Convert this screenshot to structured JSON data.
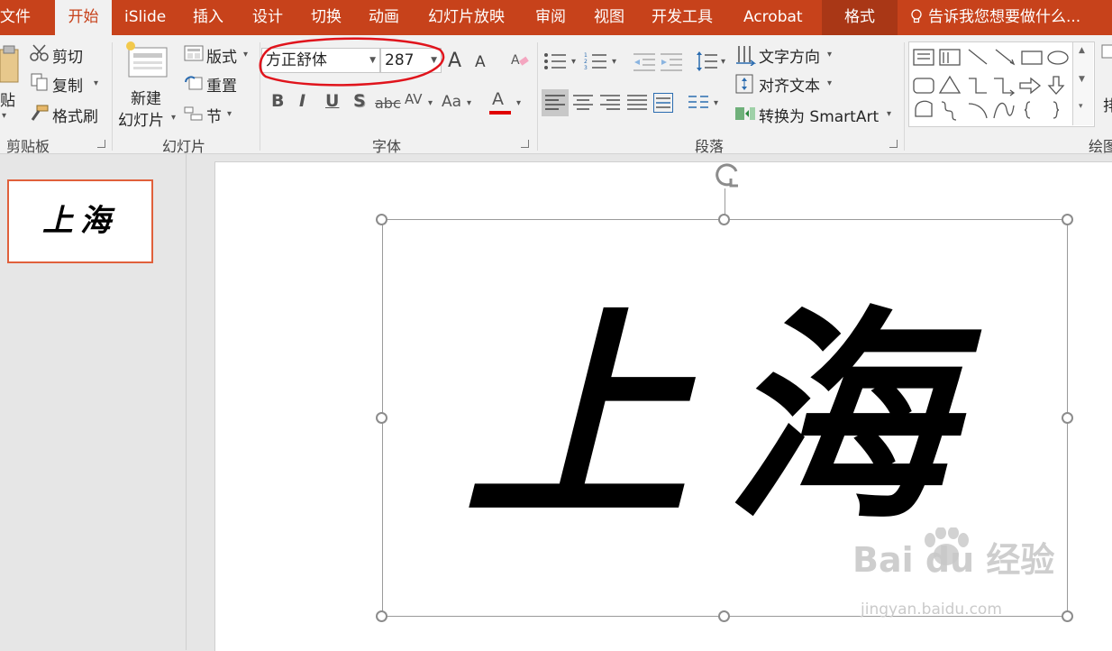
{
  "tabs": [
    {
      "label": "文件"
    },
    {
      "label": "开始"
    },
    {
      "label": "iSlide"
    },
    {
      "label": "插入"
    },
    {
      "label": "设计"
    },
    {
      "label": "切换"
    },
    {
      "label": "动画"
    },
    {
      "label": "幻灯片放映"
    },
    {
      "label": "审阅"
    },
    {
      "label": "视图"
    },
    {
      "label": "开发工具"
    },
    {
      "label": "Acrobat"
    },
    {
      "label": "格式"
    }
  ],
  "tell_me": "告诉我您想要做什么...",
  "clipboard": {
    "paste": "贴",
    "cut": "剪切",
    "copy": "复制",
    "format_painter": "格式刷",
    "group": "剪贴板"
  },
  "slides_group": {
    "new_slide_line1": "新建",
    "new_slide_line2": "幻灯片",
    "layout": "版式",
    "reset": "重置",
    "section": "节",
    "group": "幻灯片"
  },
  "font": {
    "name": "方正舒体",
    "size": "287",
    "bold": "B",
    "italic": "I",
    "underline": "U",
    "shadow": "S",
    "strike": "abc",
    "spacing": "AV",
    "case": "Aa",
    "color": "A",
    "grow": "A",
    "shrink": "A",
    "group": "字体",
    "color_hex": "#e00000"
  },
  "paragraph": {
    "text_direction": "文字方向",
    "align_text": "对齐文本",
    "convert_smartart": "转换为 SmartArt",
    "group": "段落"
  },
  "drawing": {
    "group": "绘图",
    "arrange": "排"
  },
  "thumbnail_text": "上海",
  "slide_text": "上海",
  "watermark": {
    "main": "Bai du 经验",
    "sub": "jingyan.baidu.com"
  }
}
